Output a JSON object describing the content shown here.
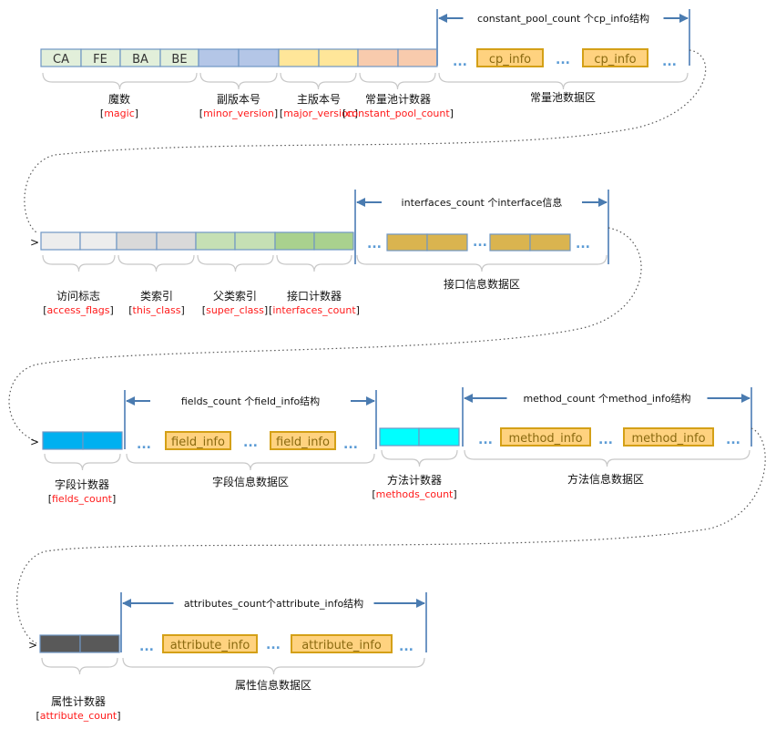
{
  "colors": {
    "magic": "#e2efda",
    "minor": "#b4c6e7",
    "major": "#ffe699",
    "cp_count": "#f8cbad",
    "cp_info": "#ffd27f",
    "info_border": "#d4a017",
    "access": "#ededed",
    "this": "#d9d9d9",
    "super": "#c5e0b4",
    "if_count": "#a9d18e",
    "interface": "#dab44f",
    "fields_count": "#00b0f0",
    "methods_count": "#00ffff",
    "attribute_count": "#595959",
    "cell_border": "#6f96c4",
    "arrow": "#4a7bb0",
    "label_red": "#ff1a1a"
  },
  "magic_bytes": [
    "CA",
    "FE",
    "BA",
    "BE"
  ],
  "row1": {
    "span_label": "constant_pool_count 个cp_info结构",
    "info_items": [
      "cp_info",
      "cp_info"
    ],
    "ellipsis": "...",
    "fields": [
      {
        "name": "魔数",
        "id": "magic"
      },
      {
        "name": "副版本号",
        "id": "minor_version"
      },
      {
        "name": "主版本号",
        "id": "major_version"
      },
      {
        "name": "常量池计数器",
        "id": "constant_pool_count"
      }
    ],
    "area_label": "常量池数据区"
  },
  "row2": {
    "span_label": "interfaces_count 个interface信息",
    "fields": [
      {
        "name": "访问标志",
        "id": "access_flags"
      },
      {
        "name": "类索引",
        "id": "this_class"
      },
      {
        "name": "父类索引",
        "id": "super_class"
      },
      {
        "name": "接口计数器",
        "id": "interfaces_count"
      }
    ],
    "area_label": "接口信息数据区"
  },
  "row3": {
    "fields_span_label": "fields_count 个field_info结构",
    "field_items": [
      "field_info",
      "field_info"
    ],
    "fields_counter": {
      "name": "字段计数器",
      "id": "fields_count"
    },
    "fields_area_label": "字段信息数据区",
    "methods_span_label": "method_count 个method_info结构",
    "method_items": [
      "method_info",
      "method_info"
    ],
    "methods_counter": {
      "name": "方法计数器",
      "id": "methods_count"
    },
    "methods_area_label": "方法信息数据区"
  },
  "row4": {
    "span_label": "attributes_count个attribute_info结构",
    "info_items": [
      "attribute_info",
      "attribute_info"
    ],
    "counter": {
      "name": "属性计数器",
      "id": "attribute_count"
    },
    "area_label": "属性信息数据区"
  },
  "bracket_open": "[",
  "bracket_close": "]",
  "continue_marker": ">"
}
